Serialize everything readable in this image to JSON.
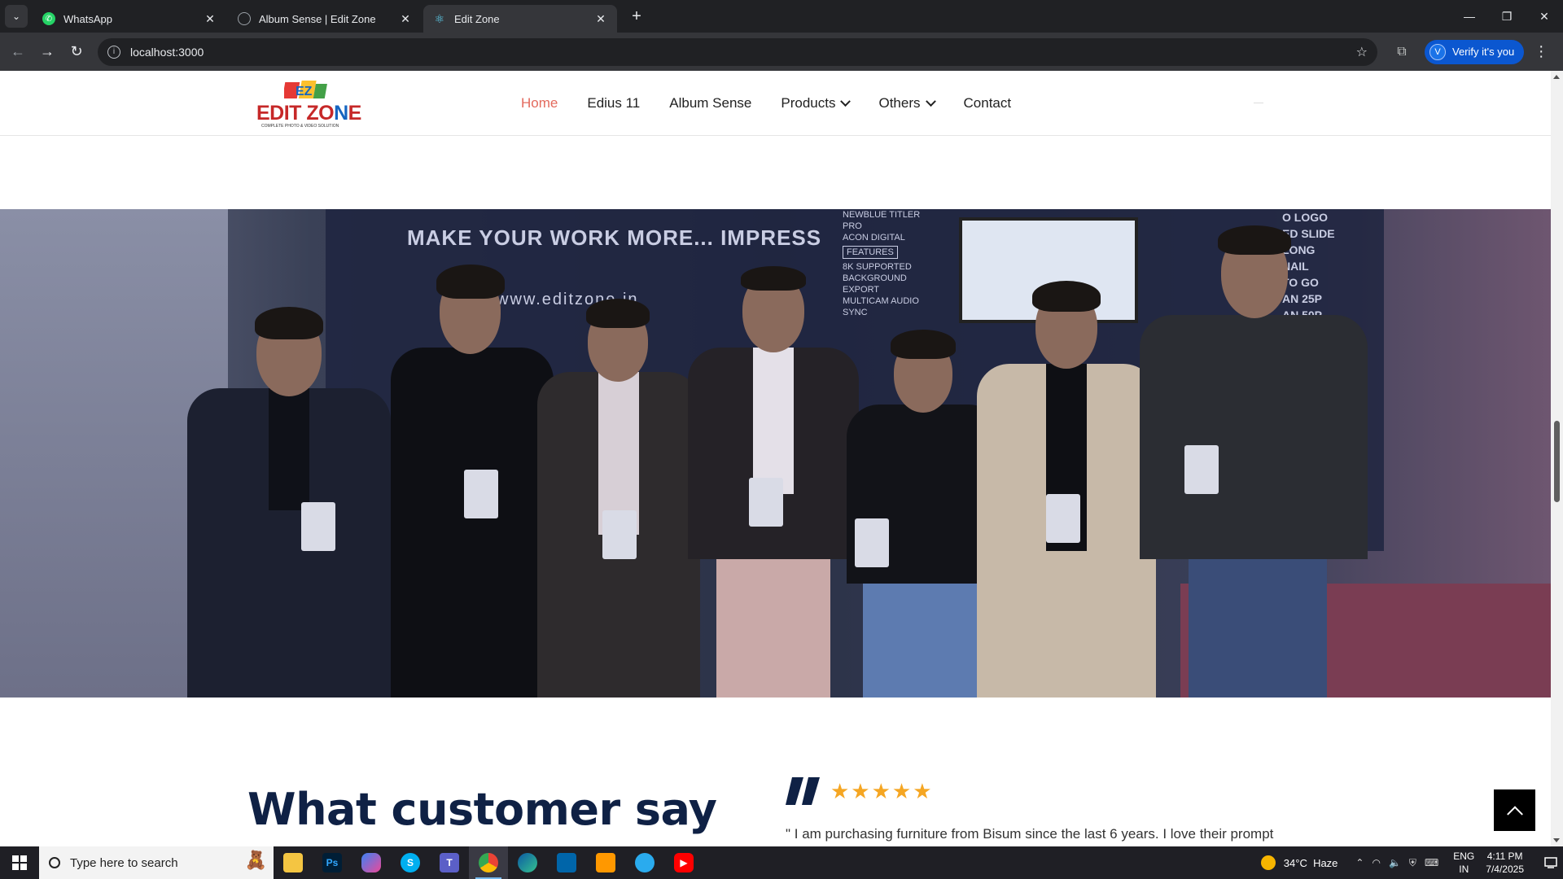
{
  "browser": {
    "tabs": [
      {
        "title": "WhatsApp",
        "icon": "whatsapp-icon",
        "active": false
      },
      {
        "title": "Album Sense | Edit Zone",
        "icon": "globe-icon",
        "active": false
      },
      {
        "title": "Edit Zone",
        "icon": "react-icon",
        "active": true
      }
    ],
    "url": "localhost:3000",
    "profile_button": "Verify it's you",
    "profile_initial": "V"
  },
  "site": {
    "logo": {
      "brand_part1": "EDIT ZO",
      "brand_z": "N",
      "brand_part2": "E",
      "mark": "EZ",
      "tagline": "COMPLETE PHOTO & VIDEO SOLUTION"
    },
    "nav": [
      {
        "label": "Home",
        "active": true,
        "dropdown": false
      },
      {
        "label": "Edius 11",
        "active": false,
        "dropdown": false
      },
      {
        "label": "Album Sense",
        "active": false,
        "dropdown": false
      },
      {
        "label": "Products",
        "active": false,
        "dropdown": true
      },
      {
        "label": "Others",
        "active": false,
        "dropdown": true
      },
      {
        "label": "Contact",
        "active": false,
        "dropdown": false
      }
    ],
    "hero": {
      "wall_text": "MAKE YOUR WORK MORE... IMPRESS",
      "wall_url": "www.editzone.in",
      "features_box": "FEATURES",
      "features_lines": [
        "NEWBLUE TITLER PRO",
        "ACON DIGITAL",
        "8K SUPPORTED",
        "BACKGROUND EXPORT",
        "MULTICAM AUDIO SYNC"
      ],
      "right_list": [
        "O LOGO",
        "ED SLIDE",
        "LONG",
        "NAIL",
        "TO GO",
        "AN 25P",
        "AN 50P"
      ]
    },
    "testimonials": {
      "heading": "What customer say",
      "stars": "★★★★★",
      "rating": 5,
      "review_text": "\" I am purchasing furniture from Bisum since the last 6 years. I love their prompt"
    }
  },
  "taskbar": {
    "search_placeholder": "Type here to search",
    "apps": [
      {
        "name": "file-explorer-icon",
        "label": ""
      },
      {
        "name": "photoshop-icon",
        "label": "Ps"
      },
      {
        "name": "copilot-icon",
        "label": ""
      },
      {
        "name": "skype-icon",
        "label": "S"
      },
      {
        "name": "teams-icon",
        "label": "T"
      },
      {
        "name": "chrome-icon",
        "label": ""
      },
      {
        "name": "edge-icon",
        "label": ""
      },
      {
        "name": "vscode-icon",
        "label": ""
      },
      {
        "name": "sublime-icon",
        "label": ""
      },
      {
        "name": "telegram-icon",
        "label": ""
      },
      {
        "name": "youtube-icon",
        "label": ""
      }
    ],
    "weather_temp": "34°C",
    "weather_desc": "Haze",
    "lang_line1": "ENG",
    "lang_line2": "IN",
    "time": "4:11 PM",
    "date": "7/4/2025"
  },
  "colors": {
    "accent": "#e36a5d",
    "heading": "#0f2145",
    "stars": "#f5a623",
    "chrome_dark": "#202124"
  }
}
